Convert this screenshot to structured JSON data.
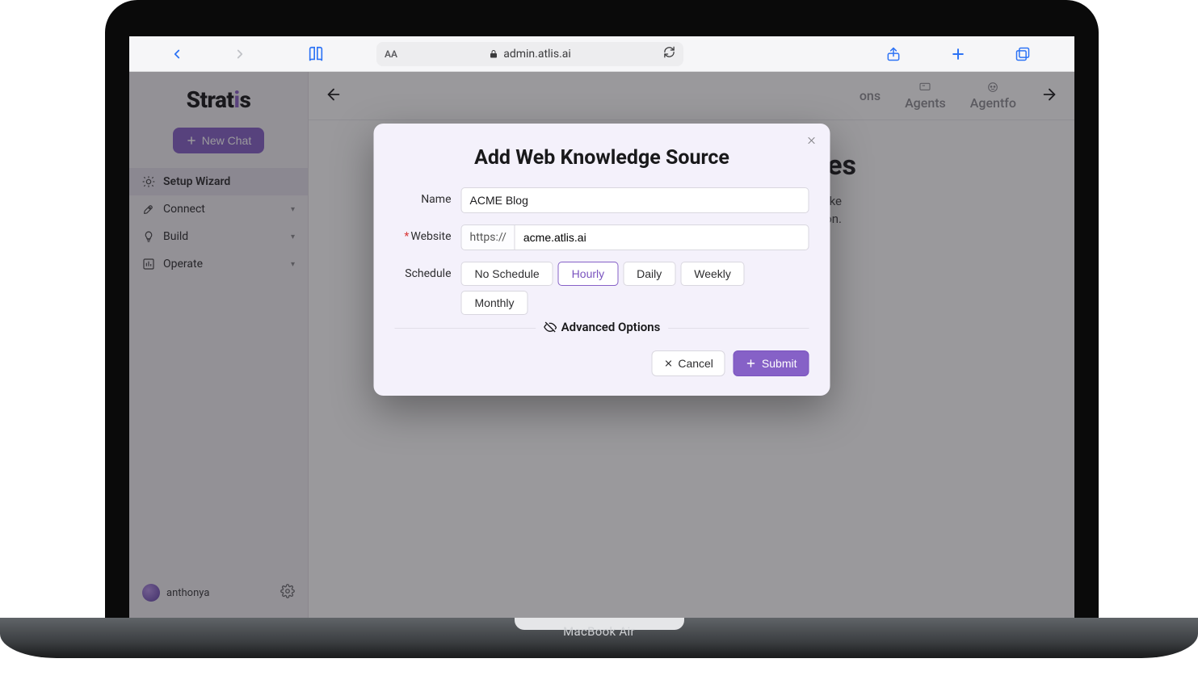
{
  "device_label": "MacBook Air",
  "browser": {
    "url_display": "admin.atlis.ai",
    "text_size_label": "AA"
  },
  "sidebar": {
    "logo_pre": "Strat",
    "logo_accent": "i",
    "logo_post": "s",
    "new_chat_label": "New Chat",
    "items": [
      {
        "label": "Setup Wizard",
        "active": true,
        "expandable": false
      },
      {
        "label": "Connect",
        "active": false,
        "expandable": true
      },
      {
        "label": "Build",
        "active": false,
        "expandable": true
      },
      {
        "label": "Operate",
        "active": false,
        "expandable": true
      }
    ],
    "user": "anthonya"
  },
  "top_tabs": {
    "visible_partial_left": "ons",
    "items": [
      "Agents",
      "Agentfo"
    ]
  },
  "page": {
    "heading_partial": "es",
    "desc_line1_partial": "ule you choose, I'll take",
    "desc_line2_partial": "e latest information."
  },
  "modal": {
    "title": "Add Web Knowledge Source",
    "name_label": "Name",
    "name_value": "ACME Blog",
    "website_label": "Website",
    "website_required": "*",
    "url_prefix": "https://",
    "url_value": "acme.atlis.ai",
    "schedule_label": "Schedule",
    "schedule_options": [
      "No Schedule",
      "Hourly",
      "Daily",
      "Weekly",
      "Monthly"
    ],
    "schedule_selected": "Hourly",
    "advanced_label": "Advanced Options",
    "cancel_label": "Cancel",
    "submit_label": "Submit"
  }
}
